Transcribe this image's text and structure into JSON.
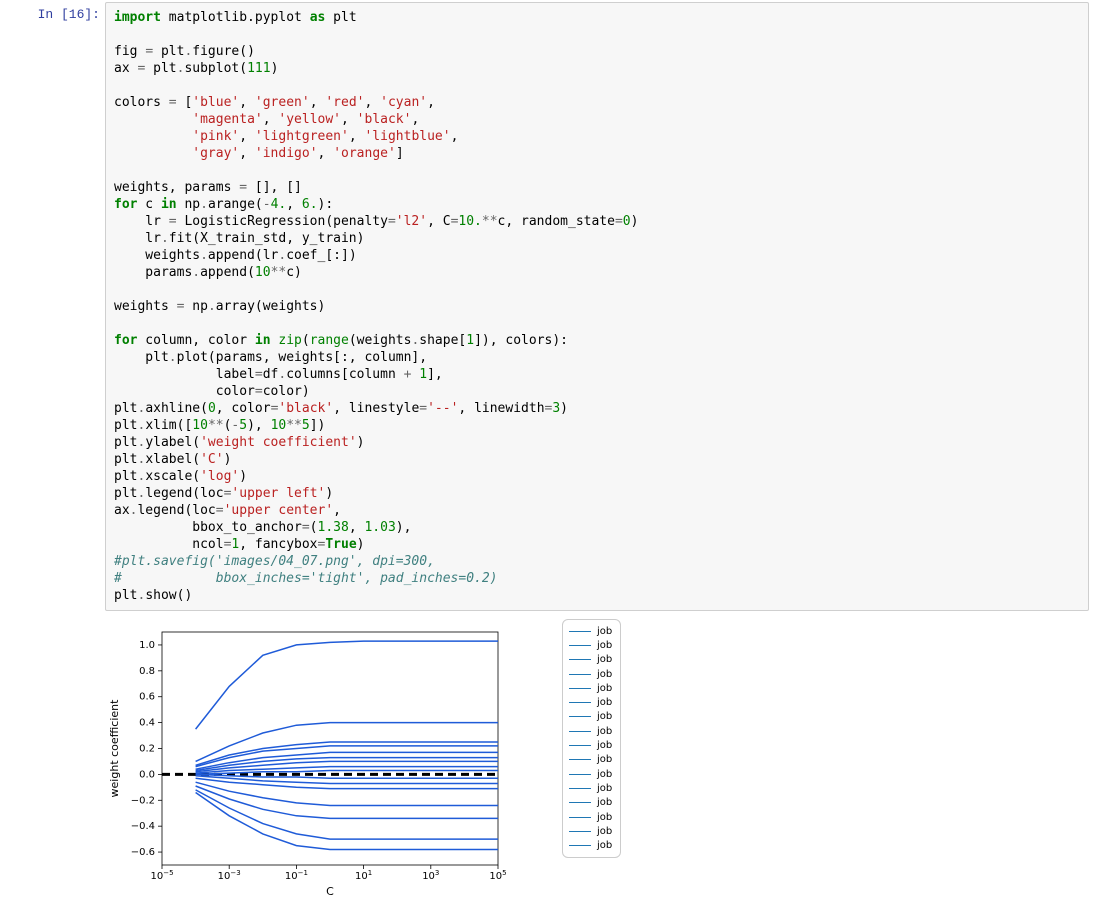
{
  "input_prompt": "In [16]:",
  "code_tokens": [
    [
      [
        "kw",
        "import"
      ],
      [
        "name",
        " matplotlib.pyplot "
      ],
      [
        "kw",
        "as"
      ],
      [
        "name",
        " plt"
      ]
    ],
    [],
    [
      [
        "name",
        "fig "
      ],
      [
        "op",
        "="
      ],
      [
        "name",
        " plt"
      ],
      [
        "op",
        "."
      ],
      [
        "name",
        "figure()"
      ]
    ],
    [
      [
        "name",
        "ax "
      ],
      [
        "op",
        "="
      ],
      [
        "name",
        " plt"
      ],
      [
        "op",
        "."
      ],
      [
        "name",
        "subplot("
      ],
      [
        "num",
        "111"
      ],
      [
        "name",
        ")"
      ]
    ],
    [],
    [
      [
        "name",
        "colors "
      ],
      [
        "op",
        "="
      ],
      [
        "name",
        " ["
      ],
      [
        "str",
        "'blue'"
      ],
      [
        "name",
        ", "
      ],
      [
        "str",
        "'green'"
      ],
      [
        "name",
        ", "
      ],
      [
        "str",
        "'red'"
      ],
      [
        "name",
        ", "
      ],
      [
        "str",
        "'cyan'"
      ],
      [
        "name",
        ","
      ]
    ],
    [
      [
        "name",
        "          "
      ],
      [
        "str",
        "'magenta'"
      ],
      [
        "name",
        ", "
      ],
      [
        "str",
        "'yellow'"
      ],
      [
        "name",
        ", "
      ],
      [
        "str",
        "'black'"
      ],
      [
        "name",
        ","
      ]
    ],
    [
      [
        "name",
        "          "
      ],
      [
        "str",
        "'pink'"
      ],
      [
        "name",
        ", "
      ],
      [
        "str",
        "'lightgreen'"
      ],
      [
        "name",
        ", "
      ],
      [
        "str",
        "'lightblue'"
      ],
      [
        "name",
        ","
      ]
    ],
    [
      [
        "name",
        "          "
      ],
      [
        "str",
        "'gray'"
      ],
      [
        "name",
        ", "
      ],
      [
        "str",
        "'indigo'"
      ],
      [
        "name",
        ", "
      ],
      [
        "str",
        "'orange'"
      ],
      [
        "name",
        "]"
      ]
    ],
    [],
    [
      [
        "name",
        "weights, params "
      ],
      [
        "op",
        "="
      ],
      [
        "name",
        " [], []"
      ]
    ],
    [
      [
        "kw",
        "for"
      ],
      [
        "name",
        " c "
      ],
      [
        "kw",
        "in"
      ],
      [
        "name",
        " np"
      ],
      [
        "op",
        "."
      ],
      [
        "name",
        "arange("
      ],
      [
        "op",
        "-"
      ],
      [
        "num",
        "4."
      ],
      [
        "name",
        ", "
      ],
      [
        "num",
        "6."
      ],
      [
        "name",
        "):"
      ]
    ],
    [
      [
        "name",
        "    lr "
      ],
      [
        "op",
        "="
      ],
      [
        "name",
        " LogisticRegression(penalty"
      ],
      [
        "op",
        "="
      ],
      [
        "str",
        "'l2'"
      ],
      [
        "name",
        ", C"
      ],
      [
        "op",
        "="
      ],
      [
        "num",
        "10."
      ],
      [
        "op",
        "**"
      ],
      [
        "name",
        "c, random_state"
      ],
      [
        "op",
        "="
      ],
      [
        "num",
        "0"
      ],
      [
        "name",
        ")"
      ]
    ],
    [
      [
        "name",
        "    lr"
      ],
      [
        "op",
        "."
      ],
      [
        "name",
        "fit(X_train_std, y_train)"
      ]
    ],
    [
      [
        "name",
        "    weights"
      ],
      [
        "op",
        "."
      ],
      [
        "name",
        "append(lr"
      ],
      [
        "op",
        "."
      ],
      [
        "name",
        "coef_[:])"
      ]
    ],
    [
      [
        "name",
        "    params"
      ],
      [
        "op",
        "."
      ],
      [
        "name",
        "append("
      ],
      [
        "num",
        "10"
      ],
      [
        "op",
        "**"
      ],
      [
        "name",
        "c)"
      ]
    ],
    [],
    [
      [
        "name",
        "weights "
      ],
      [
        "op",
        "="
      ],
      [
        "name",
        " np"
      ],
      [
        "op",
        "."
      ],
      [
        "name",
        "array(weights)"
      ]
    ],
    [],
    [
      [
        "kw",
        "for"
      ],
      [
        "name",
        " column, color "
      ],
      [
        "kw",
        "in"
      ],
      [
        "name",
        " "
      ],
      [
        "builtin",
        "zip"
      ],
      [
        "name",
        "("
      ],
      [
        "builtin",
        "range"
      ],
      [
        "name",
        "(weights"
      ],
      [
        "op",
        "."
      ],
      [
        "name",
        "shape["
      ],
      [
        "num",
        "1"
      ],
      [
        "name",
        "]), colors):"
      ]
    ],
    [
      [
        "name",
        "    plt"
      ],
      [
        "op",
        "."
      ],
      [
        "name",
        "plot(params, weights[:, column],"
      ]
    ],
    [
      [
        "name",
        "             label"
      ],
      [
        "op",
        "="
      ],
      [
        "name",
        "df"
      ],
      [
        "op",
        "."
      ],
      [
        "name",
        "columns[column "
      ],
      [
        "op",
        "+"
      ],
      [
        "name",
        " "
      ],
      [
        "num",
        "1"
      ],
      [
        "name",
        "],"
      ]
    ],
    [
      [
        "name",
        "             color"
      ],
      [
        "op",
        "="
      ],
      [
        "name",
        "color)"
      ]
    ],
    [
      [
        "name",
        "plt"
      ],
      [
        "op",
        "."
      ],
      [
        "name",
        "axhline("
      ],
      [
        "num",
        "0"
      ],
      [
        "name",
        ", color"
      ],
      [
        "op",
        "="
      ],
      [
        "str",
        "'black'"
      ],
      [
        "name",
        ", linestyle"
      ],
      [
        "op",
        "="
      ],
      [
        "str",
        "'--'"
      ],
      [
        "name",
        ", linewidth"
      ],
      [
        "op",
        "="
      ],
      [
        "num",
        "3"
      ],
      [
        "name",
        ")"
      ]
    ],
    [
      [
        "name",
        "plt"
      ],
      [
        "op",
        "."
      ],
      [
        "name",
        "xlim(["
      ],
      [
        "num",
        "10"
      ],
      [
        "op",
        "**"
      ],
      [
        "name",
        "("
      ],
      [
        "op",
        "-"
      ],
      [
        "num",
        "5"
      ],
      [
        "name",
        "), "
      ],
      [
        "num",
        "10"
      ],
      [
        "op",
        "**"
      ],
      [
        "num",
        "5"
      ],
      [
        "name",
        "])"
      ]
    ],
    [
      [
        "name",
        "plt"
      ],
      [
        "op",
        "."
      ],
      [
        "name",
        "ylabel("
      ],
      [
        "str",
        "'weight coefficient'"
      ],
      [
        "name",
        ")"
      ]
    ],
    [
      [
        "name",
        "plt"
      ],
      [
        "op",
        "."
      ],
      [
        "name",
        "xlabel("
      ],
      [
        "str",
        "'C'"
      ],
      [
        "name",
        ")"
      ]
    ],
    [
      [
        "name",
        "plt"
      ],
      [
        "op",
        "."
      ],
      [
        "name",
        "xscale("
      ],
      [
        "str",
        "'log'"
      ],
      [
        "name",
        ")"
      ]
    ],
    [
      [
        "name",
        "plt"
      ],
      [
        "op",
        "."
      ],
      [
        "name",
        "legend(loc"
      ],
      [
        "op",
        "="
      ],
      [
        "str",
        "'upper left'"
      ],
      [
        "name",
        ")"
      ]
    ],
    [
      [
        "name",
        "ax"
      ],
      [
        "op",
        "."
      ],
      [
        "name",
        "legend(loc"
      ],
      [
        "op",
        "="
      ],
      [
        "str",
        "'upper center'"
      ],
      [
        "name",
        ","
      ]
    ],
    [
      [
        "name",
        "          bbox_to_anchor"
      ],
      [
        "op",
        "="
      ],
      [
        "name",
        "("
      ],
      [
        "num",
        "1.38"
      ],
      [
        "name",
        ", "
      ],
      [
        "num",
        "1.03"
      ],
      [
        "name",
        "),"
      ]
    ],
    [
      [
        "name",
        "          ncol"
      ],
      [
        "op",
        "="
      ],
      [
        "num",
        "1"
      ],
      [
        "name",
        ", fancybox"
      ],
      [
        "op",
        "="
      ],
      [
        "bool",
        "True"
      ],
      [
        "name",
        ")"
      ]
    ],
    [
      [
        "comment",
        "#plt.savefig('images/04_07.png', dpi=300,"
      ]
    ],
    [
      [
        "comment",
        "#            bbox_inches='tight', pad_inches=0.2)"
      ]
    ],
    [
      [
        "name",
        "plt"
      ],
      [
        "op",
        "."
      ],
      [
        "name",
        "show()"
      ]
    ]
  ],
  "legend_entries": [
    "job",
    "job",
    "job",
    "job",
    "job",
    "job",
    "job",
    "job",
    "job",
    "job",
    "job",
    "job",
    "job",
    "job",
    "job",
    "job"
  ],
  "legend_color": "#1f77b4",
  "chart_data": {
    "type": "line",
    "xlabel": "C",
    "ylabel": "weight coefficient",
    "xscale": "log",
    "xlim": [
      1e-05,
      100000
    ],
    "ylim": [
      -0.7,
      1.1
    ],
    "yticks": [
      -0.6,
      -0.4,
      -0.2,
      0.0,
      0.2,
      0.4,
      0.6,
      0.8,
      1.0
    ],
    "xticks": [
      1e-05,
      0.001,
      0.1,
      10,
      1000,
      100000
    ],
    "xtick_labels": [
      "10⁻⁵",
      "10⁻³",
      "10⁻¹",
      "10¹",
      "10³",
      "10⁵"
    ],
    "axhline": {
      "y": 0,
      "color": "#000000",
      "style": "dashed",
      "width": 3
    },
    "x": [
      0.0001,
      0.001,
      0.01,
      0.1,
      1,
      10,
      100,
      1000,
      10000,
      100000
    ],
    "series": [
      {
        "name": "job",
        "color": "#1f5bd8",
        "values": [
          0.35,
          0.68,
          0.92,
          1.0,
          1.02,
          1.03,
          1.03,
          1.03,
          1.03,
          1.03
        ]
      },
      {
        "name": "job",
        "color": "#1f5bd8",
        "values": [
          0.1,
          0.22,
          0.32,
          0.38,
          0.4,
          0.4,
          0.4,
          0.4,
          0.4,
          0.4
        ]
      },
      {
        "name": "job",
        "color": "#1f5bd8",
        "values": [
          0.07,
          0.15,
          0.2,
          0.23,
          0.25,
          0.25,
          0.25,
          0.25,
          0.25,
          0.25
        ]
      },
      {
        "name": "job",
        "color": "#1f5bd8",
        "values": [
          0.06,
          0.13,
          0.18,
          0.2,
          0.22,
          0.22,
          0.22,
          0.22,
          0.22,
          0.22
        ]
      },
      {
        "name": "job",
        "color": "#1f5bd8",
        "values": [
          0.04,
          0.09,
          0.13,
          0.15,
          0.17,
          0.17,
          0.17,
          0.17,
          0.17,
          0.17
        ]
      },
      {
        "name": "job",
        "color": "#1f5bd8",
        "values": [
          0.03,
          0.07,
          0.1,
          0.12,
          0.13,
          0.13,
          0.13,
          0.13,
          0.13,
          0.13
        ]
      },
      {
        "name": "job",
        "color": "#1f5bd8",
        "values": [
          0.02,
          0.05,
          0.07,
          0.09,
          0.1,
          0.1,
          0.1,
          0.1,
          0.1,
          0.1
        ]
      },
      {
        "name": "job",
        "color": "#1f5bd8",
        "values": [
          0.01,
          0.03,
          0.04,
          0.05,
          0.06,
          0.06,
          0.06,
          0.06,
          0.06,
          0.06
        ]
      },
      {
        "name": "job",
        "color": "#1f5bd8",
        "values": [
          0.0,
          0.01,
          0.02,
          0.02,
          0.03,
          0.03,
          0.03,
          0.03,
          0.03,
          0.03
        ]
      },
      {
        "name": "job",
        "color": "#1f5bd8",
        "values": [
          -0.0,
          -0.01,
          -0.02,
          -0.02,
          -0.03,
          -0.03,
          -0.03,
          -0.03,
          -0.03,
          -0.03
        ]
      },
      {
        "name": "job",
        "color": "#1f5bd8",
        "values": [
          -0.01,
          -0.03,
          -0.05,
          -0.06,
          -0.07,
          -0.07,
          -0.07,
          -0.07,
          -0.07,
          -0.07
        ]
      },
      {
        "name": "job",
        "color": "#1f5bd8",
        "values": [
          -0.03,
          -0.06,
          -0.08,
          -0.1,
          -0.11,
          -0.11,
          -0.11,
          -0.11,
          -0.11,
          -0.11
        ]
      },
      {
        "name": "job",
        "color": "#1f5bd8",
        "values": [
          -0.06,
          -0.13,
          -0.18,
          -0.22,
          -0.24,
          -0.24,
          -0.24,
          -0.24,
          -0.24,
          -0.24
        ]
      },
      {
        "name": "job",
        "color": "#1f5bd8",
        "values": [
          -0.09,
          -0.19,
          -0.27,
          -0.32,
          -0.34,
          -0.34,
          -0.34,
          -0.34,
          -0.34,
          -0.34
        ]
      },
      {
        "name": "job",
        "color": "#1f5bd8",
        "values": [
          -0.12,
          -0.26,
          -0.38,
          -0.46,
          -0.5,
          -0.5,
          -0.5,
          -0.5,
          -0.5,
          -0.5
        ]
      },
      {
        "name": "job",
        "color": "#1f5bd8",
        "values": [
          -0.14,
          -0.32,
          -0.46,
          -0.55,
          -0.58,
          -0.58,
          -0.58,
          -0.58,
          -0.58,
          -0.58
        ]
      }
    ]
  }
}
